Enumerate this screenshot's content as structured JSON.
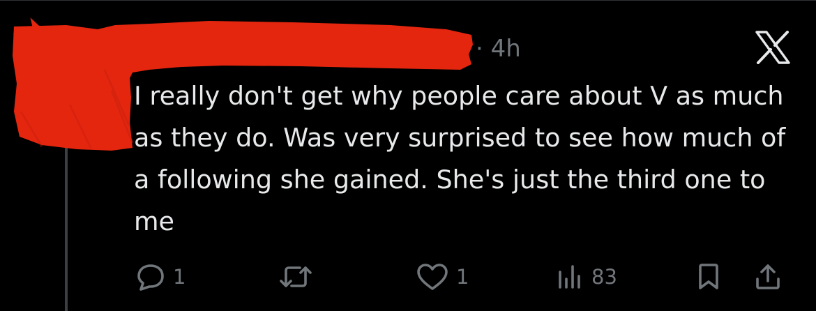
{
  "tweet": {
    "time_ago": "· 4h",
    "text": "I really don't get why people care about V as much as they do. Was very surprised to see how much of a following she gained. She's just the third one to me",
    "author_redacted": true
  },
  "actions": {
    "replies": "1",
    "retweets": "",
    "likes": "1",
    "views": "83"
  },
  "icons": {
    "reply": "reply-icon",
    "retweet": "retweet-icon",
    "like": "heart-icon",
    "views": "views-icon",
    "bookmark": "bookmark-icon",
    "share": "share-icon",
    "platform": "x-logo-icon"
  },
  "colors": {
    "background": "#000000",
    "text": "#e7e9ea",
    "muted": "#71767b",
    "redaction": "#e5260f"
  }
}
